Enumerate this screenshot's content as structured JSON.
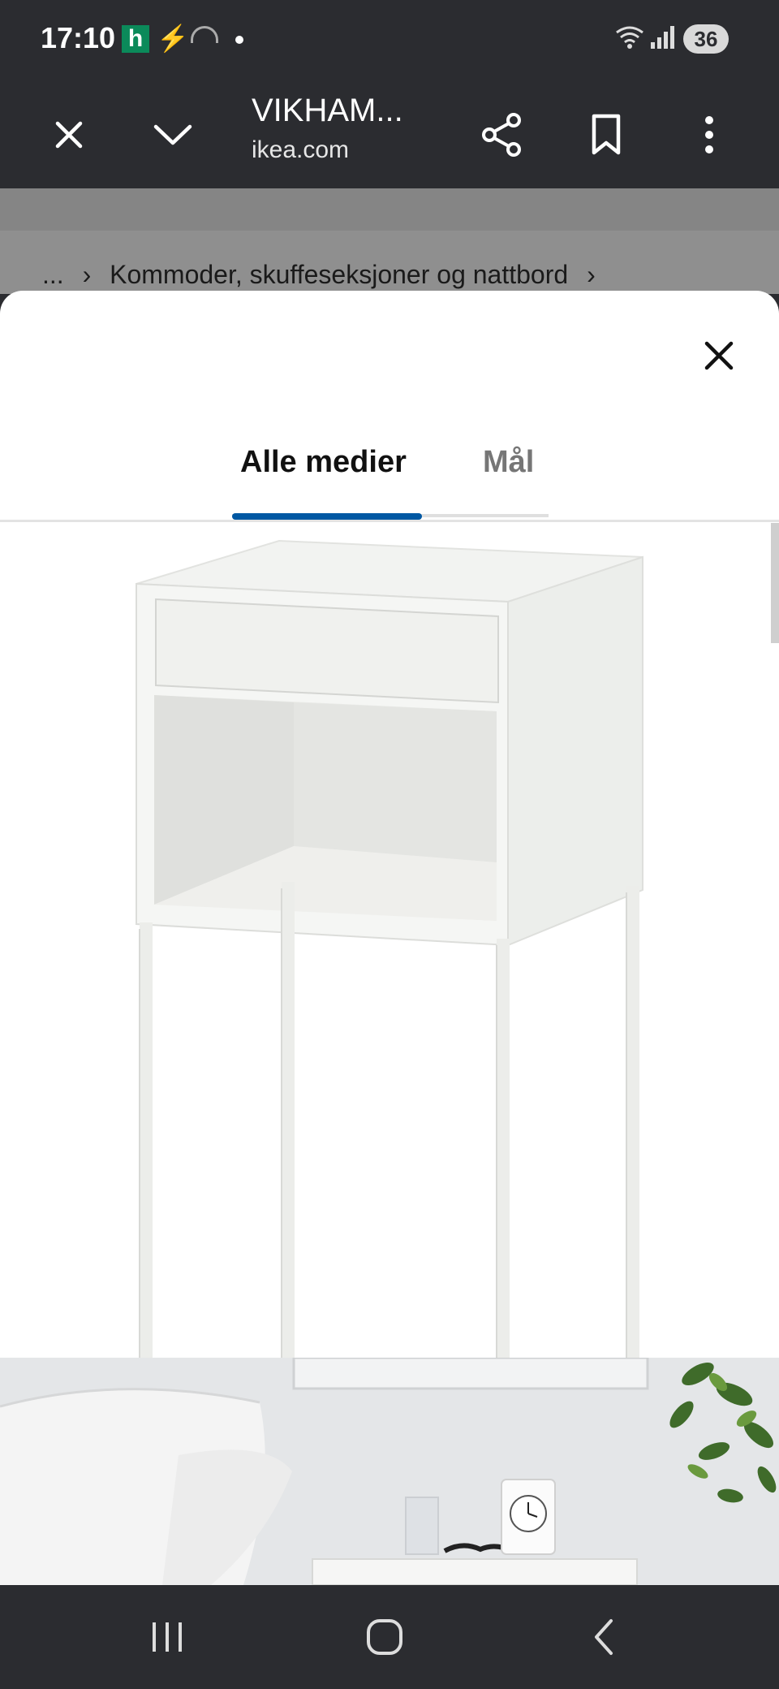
{
  "status_bar": {
    "time": "17:10",
    "app_badge": "h",
    "battery": "36",
    "icons": [
      "h-app-icon",
      "bolt-icon",
      "speedometer-icon",
      "dot-icon",
      "wifi-icon",
      "signal-icon",
      "battery-icon"
    ]
  },
  "browser": {
    "title": "VIKHAM...",
    "domain": "ikea.com",
    "icons": [
      "close-icon",
      "chevron-down-icon",
      "share-icon",
      "bookmark-icon",
      "more-vert-icon"
    ]
  },
  "breadcrumb": {
    "ellipsis": "...",
    "category": "Kommoder, skuffeseksjoner og nattbord"
  },
  "media_sheet": {
    "tabs": [
      {
        "label": "Alle medier",
        "active": true
      },
      {
        "label": "Mål",
        "active": false
      }
    ],
    "accent_color": "#0058a3",
    "images": [
      "product-white-nightstand",
      "room-scene-nightstand"
    ]
  },
  "nav_bar": {
    "icons": [
      "recent-apps-icon",
      "home-icon",
      "back-icon"
    ]
  }
}
